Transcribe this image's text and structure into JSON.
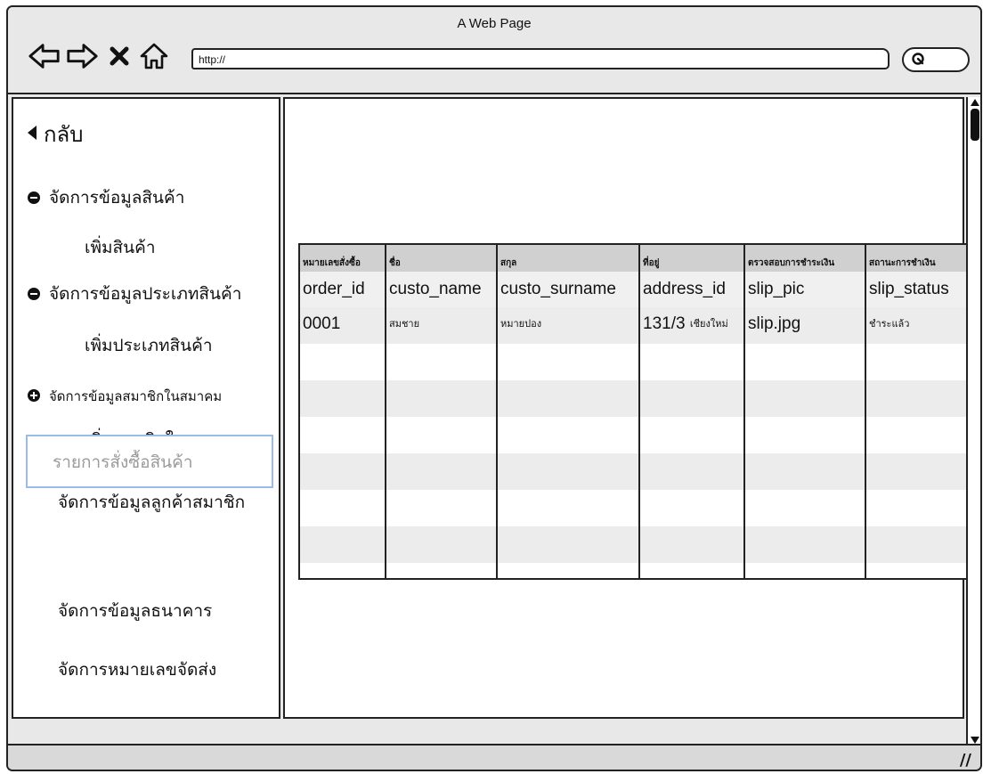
{
  "window": {
    "title": "A Web Page"
  },
  "toolbar": {
    "back_icon": "back-arrow-icon",
    "forward_icon": "forward-arrow-icon",
    "close_icon": "close-icon",
    "home_icon": "home-icon",
    "url_value": "http://",
    "search_icon": "search-icon"
  },
  "sidebar": {
    "back_label": "กลับ",
    "items": [
      {
        "label": "จัดการข้อมูลสินค้า",
        "marker": "minus"
      },
      {
        "label": "เพิ่มสินค้า",
        "marker": "none"
      },
      {
        "label": "จัดการข้อมูลประเภทสินค้า",
        "marker": "minus"
      },
      {
        "label": "เพิ่มประเภทสินค้า",
        "marker": "none"
      },
      {
        "label": "จัดการข้อมูลสมาชิกในสมาคม",
        "marker": "plus"
      },
      {
        "label": "เพิ่มสมาชิกในสมาคม",
        "marker": "none"
      },
      {
        "label": "จัดการข้อมูลลูกค้าสมาชิก",
        "marker": "none"
      },
      {
        "label": "รายการสั่งซื้อสินค้า",
        "marker": "none",
        "selected": true
      },
      {
        "label": "จัดการข้อมูลธนาคาร",
        "marker": "none"
      },
      {
        "label": "จัดการหมายเลขจัดส่ง",
        "marker": "none"
      }
    ]
  },
  "table": {
    "headers_th": [
      "หมายเลขสั่งซื้อ",
      "ชื่อ",
      "สกุล",
      "ที่อยู่",
      "ตรวจสอบการชำระเงิน",
      "สถานะการชำเงิน"
    ],
    "columns": [
      "order_id",
      "custo_name",
      "custo_surname",
      "address_id",
      "slip_pic",
      "slip_status"
    ],
    "rows": [
      [
        "0001",
        "สมชาย",
        "หมายปอง",
        "131/3",
        "slip.jpg",
        "ชำระแล้ว"
      ]
    ],
    "address_suffix": "เชียงใหม่"
  }
}
